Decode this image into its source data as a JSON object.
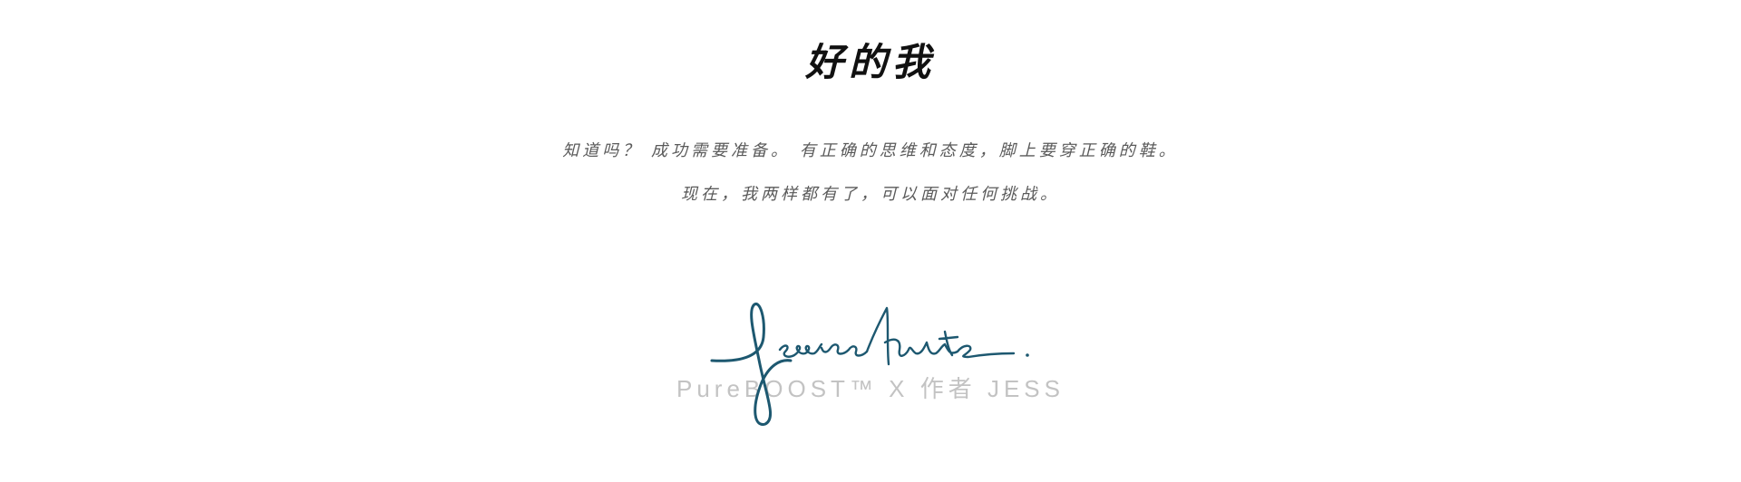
{
  "headline": "好的我",
  "body": {
    "line_1": "知道吗？ 成功需要准备。 有正确的思维和态度，脚上要穿正确的鞋。",
    "line_2": "现在，我两样都有了，可以面对任何挑战。"
  },
  "signature": {
    "text": "Jessica Hunter",
    "color": "#1d5870"
  },
  "product_credit": "PureBOOST™ X  作者 JESS"
}
